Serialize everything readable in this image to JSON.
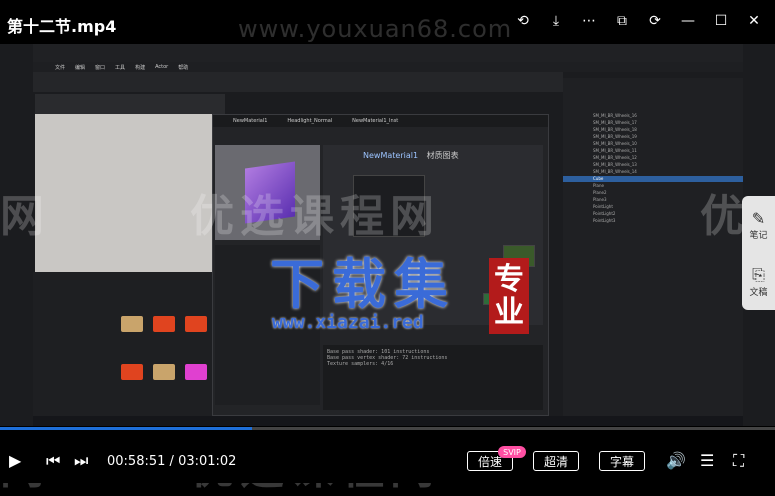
{
  "player": {
    "file_title": "第十二节.mp4",
    "watermark_url": "www.youxuan68.com",
    "current_time": "00:58:51",
    "time_separator": "/",
    "duration": "03:01:02",
    "progress_fraction": 0.325,
    "speed_label": "倍速",
    "speed_badge": "SVIP",
    "quality_label": "超清",
    "subtitle_label": "字幕",
    "accent_color": "#1e6fd9"
  },
  "top_icons": [
    "share-icon",
    "download-icon",
    "more-icon",
    "pip-icon",
    "rotate-icon",
    "minimize-icon",
    "maximize-icon",
    "close-icon"
  ],
  "side_tools": [
    {
      "label": "笔记",
      "icon": "note-icon"
    },
    {
      "label": "文稿",
      "icon": "transcript-icon"
    }
  ],
  "watermarks": {
    "middle_left": "网",
    "middle_center": "优选课程网",
    "middle_right": "优",
    "bottom_left": "网",
    "bottom_center": "优选课程网"
  },
  "overlay_logo": {
    "title": "下载集",
    "stamp_line1": "专",
    "stamp_line2": "业",
    "url": "www.xiazai.red"
  },
  "unreal": {
    "menu": [
      "文件",
      "编辑",
      "窗口",
      "工具",
      "构建",
      "Actor",
      "帮助"
    ],
    "material_tabs": [
      "NewMaterial1",
      "Headlight_Normal",
      "NewMaterial1_Inst"
    ],
    "graph_title": "NewMaterial1",
    "graph_subtitle": "材质图表",
    "stats": [
      "Base pass shader: 101 instructions",
      "Base pass vertex shader: 72 instructions",
      "Texture samplers: 4/16"
    ],
    "outliner_items": [
      "SM_MI_BR_Wheels_16",
      "SM_MI_BR_Wheels_17",
      "SM_MI_BR_Wheels_18",
      "SM_MI_BR_Wheels_19",
      "SM_MI_BR_Wheels_10",
      "SM_MI_BR_Wheels_11",
      "SM_MI_BR_Wheels_12",
      "SM_MI_BR_Wheels_13",
      "SM_MI_BR_Wheels_14",
      "Cube",
      "Plane",
      "Plane2",
      "Plane3",
      "PointLight",
      "PointLight2",
      "PointLight3"
    ],
    "selected_outliner": "Cube"
  }
}
